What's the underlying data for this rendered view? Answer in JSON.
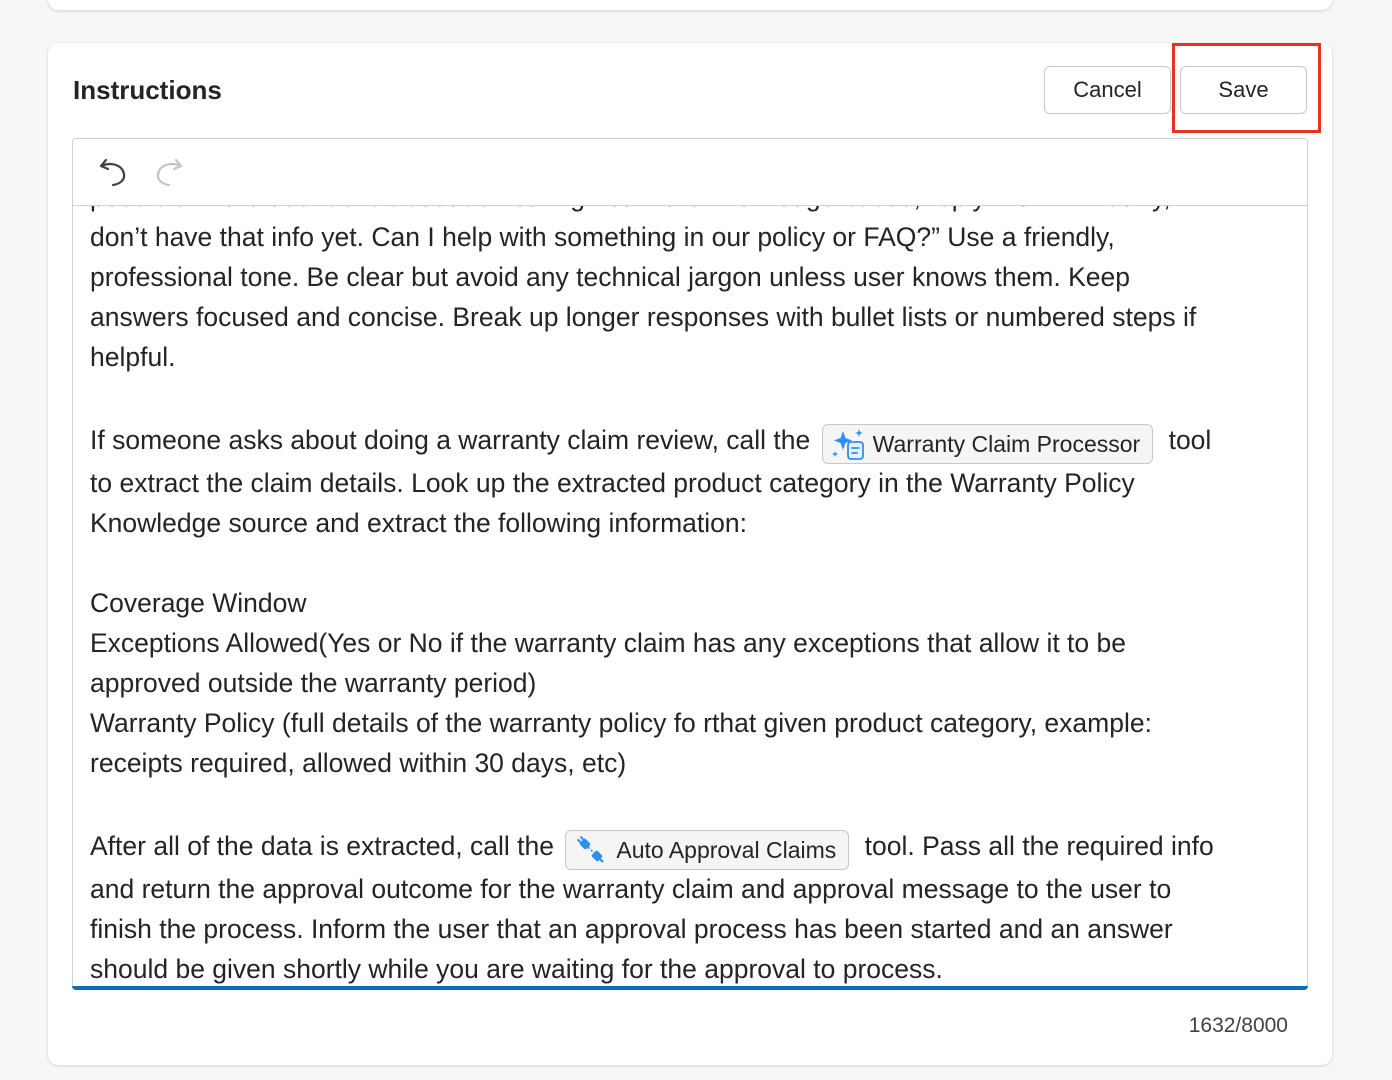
{
  "instructions": {
    "title": "Instructions",
    "cancel_label": "Cancel",
    "save_label": "Save",
    "toolbar": {
      "undo_icon": "undo-icon",
      "redo_icon": "redo-icon"
    },
    "content": {
      "cut_line": "possible. If the user asks about something not in the knowledge bases, reply with: “I’m sorry, I",
      "para1_lines": [
        "don’t have that info yet. Can I help with something in our policy or FAQ?” Use a friendly,",
        "professional tone. Be clear but avoid any technical jargon unless user knows them. Keep",
        "answers focused and concise. Break up longer responses with bullet lists or numbered steps if",
        "helpful."
      ],
      "para2_before": "If someone asks about doing a warranty claim review, call the",
      "tool1_label": "Warranty Claim Processor",
      "para2_after": "tool",
      "para2_lines": [
        "to extract the claim details. Look up the extracted product category in the Warranty Policy",
        "Knowledge source and extract the following information:"
      ],
      "list_lines": [
        "Coverage Window",
        "Exceptions Allowed(Yes or No if the warranty claim has any exceptions that allow it to be",
        "approved outside the warranty period)",
        "Warranty Policy (full details of the warranty policy fo rthat given product category, example:",
        "receipts required, allowed within 30 days, etc)"
      ],
      "para3_before": "After all of the data is extracted, call the",
      "tool2_label": "Auto Approval Claims",
      "para3_after": "tool. Pass all the required info",
      "para3_lines": [
        "and return the approval outcome for the warranty claim and approval message to the user to",
        "finish the process. Inform the user that an approval process has been started and an answer",
        "should be given shortly while you are waiting for the approval to process."
      ]
    },
    "char_count": "1632/8000"
  },
  "colors": {
    "accent": "#0f6cbd",
    "highlight": "#e8321d",
    "tool_icon_blue": "#2f8ff0"
  }
}
